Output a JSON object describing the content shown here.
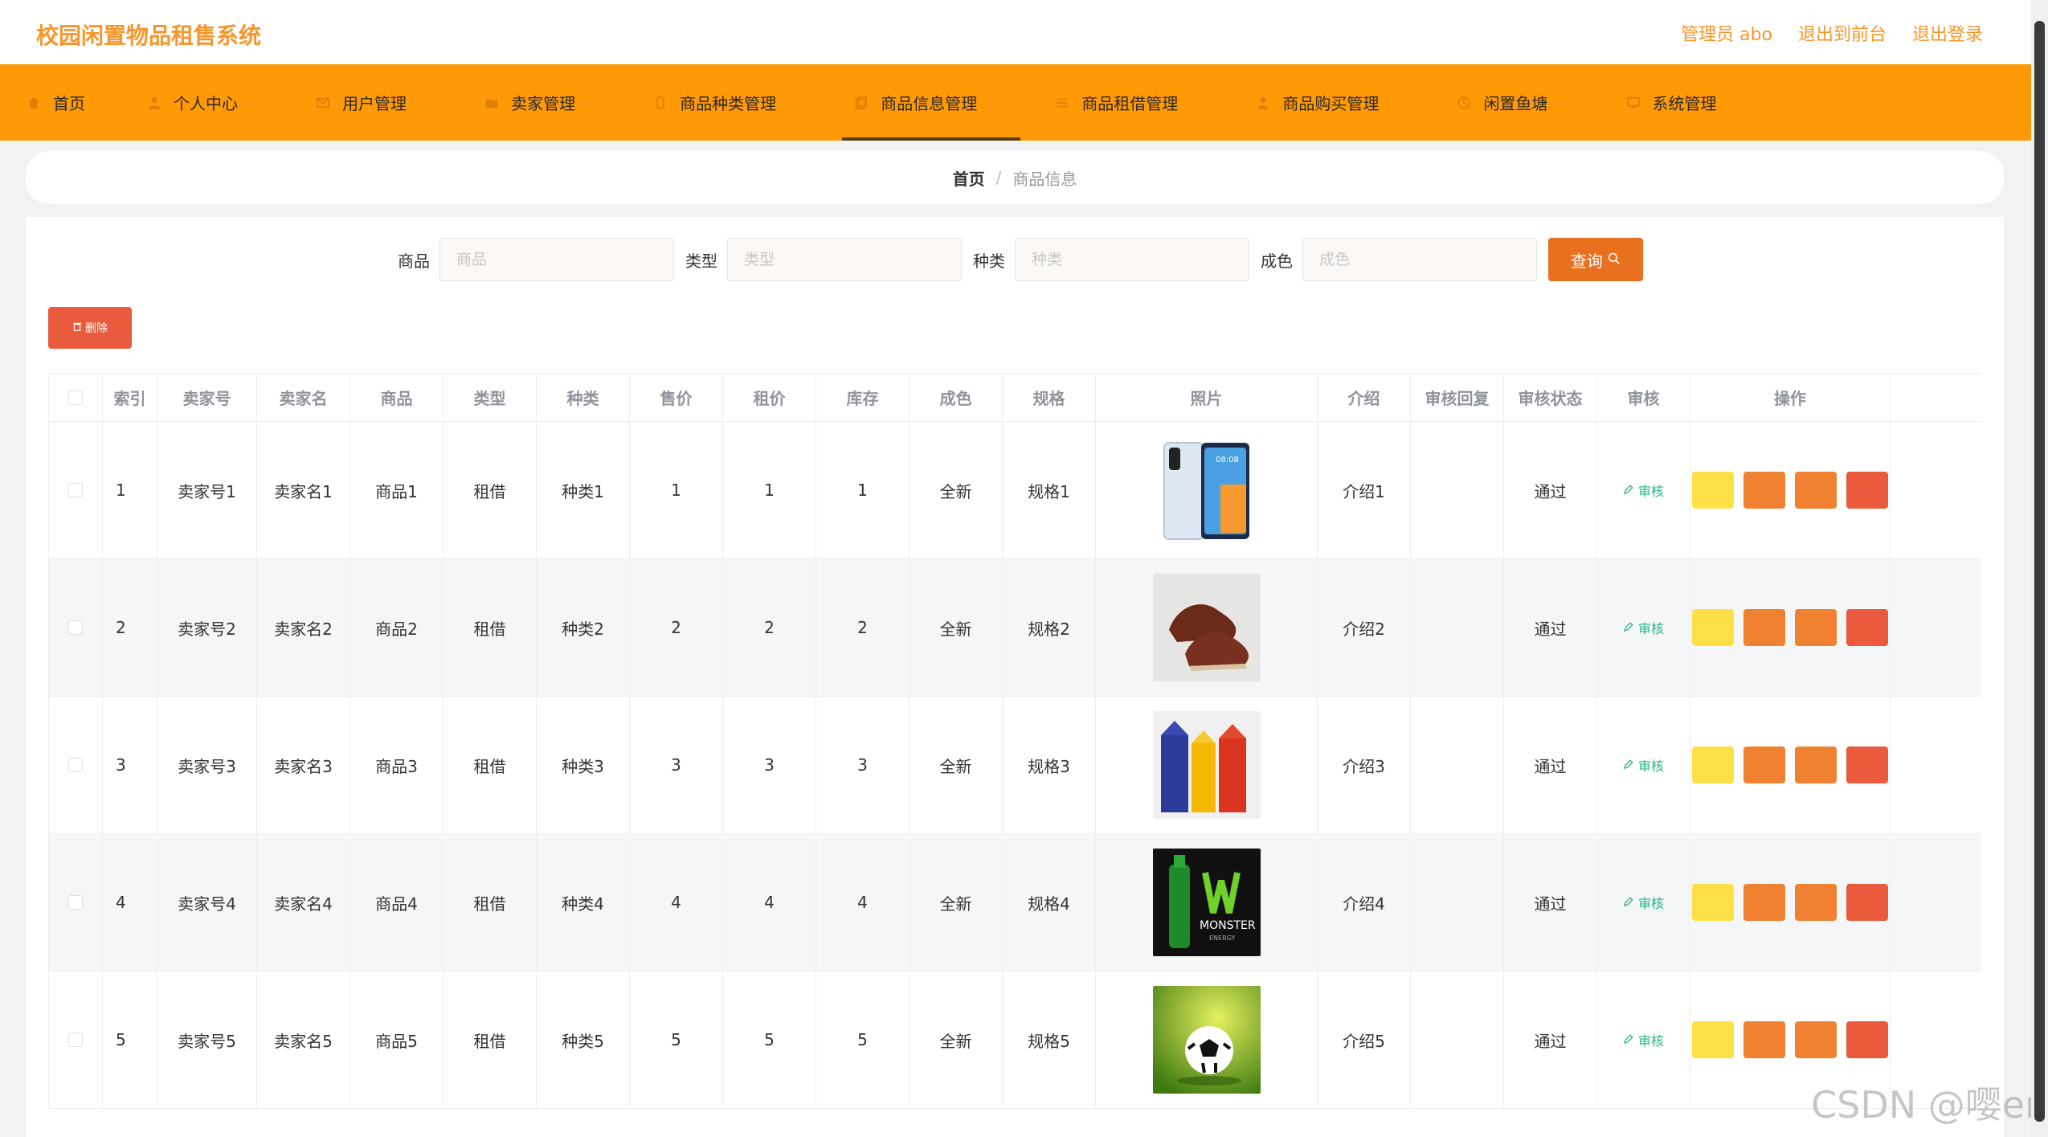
{
  "header": {
    "title": "校园闲置物品租售系统",
    "admin": "管理员 abo",
    "to_front": "退出到前台",
    "logout": "退出登录"
  },
  "nav": [
    {
      "label": "首页",
      "icon": "home-icon"
    },
    {
      "label": "个人中心",
      "icon": "user-icon"
    },
    {
      "label": "用户管理",
      "icon": "mail-icon"
    },
    {
      "label": "卖家管理",
      "icon": "folder-icon"
    },
    {
      "label": "商品种类管理",
      "icon": "phone-icon"
    },
    {
      "label": "商品信息管理",
      "icon": "copy-icon"
    },
    {
      "label": "商品租借管理",
      "icon": "list-icon"
    },
    {
      "label": "商品购买管理",
      "icon": "person-icon"
    },
    {
      "label": "闲置鱼塘",
      "icon": "clock-icon"
    },
    {
      "label": "系统管理",
      "icon": "screen-icon"
    }
  ],
  "breadcrumb": {
    "home": "首页",
    "current": "商品信息"
  },
  "search": {
    "fields": [
      {
        "label": "商品",
        "placeholder": "商品"
      },
      {
        "label": "类型",
        "placeholder": "类型"
      },
      {
        "label": "种类",
        "placeholder": "种类"
      },
      {
        "label": "成色",
        "placeholder": "成色"
      }
    ],
    "query_label": "查询"
  },
  "delete_label": "删除",
  "table": {
    "headers": [
      "",
      "索引",
      "卖家号",
      "卖家名",
      "商品",
      "类型",
      "种类",
      "售价",
      "租价",
      "库存",
      "成色",
      "规格",
      "照片",
      "介绍",
      "审核回复",
      "审核状态",
      "审核",
      "操作"
    ],
    "audit_label": "审核",
    "rows": [
      {
        "index": "1",
        "seller_no": "卖家号1",
        "seller_name": "卖家名1",
        "product": "商品1",
        "type": "租借",
        "kind": "种类1",
        "price": "1",
        "rent": "1",
        "stock": "1",
        "condition": "全新",
        "spec": "规格1",
        "photo": "phone",
        "intro": "介绍1",
        "reply": "",
        "status": "通过"
      },
      {
        "index": "2",
        "seller_no": "卖家号2",
        "seller_name": "卖家名2",
        "product": "商品2",
        "type": "租借",
        "kind": "种类2",
        "price": "2",
        "rent": "2",
        "stock": "2",
        "condition": "全新",
        "spec": "规格2",
        "photo": "shoes",
        "intro": "介绍2",
        "reply": "",
        "status": "通过"
      },
      {
        "index": "3",
        "seller_no": "卖家号3",
        "seller_name": "卖家名3",
        "product": "商品3",
        "type": "租借",
        "kind": "种类3",
        "price": "3",
        "rent": "3",
        "stock": "3",
        "condition": "全新",
        "spec": "规格3",
        "photo": "boxes",
        "intro": "介绍3",
        "reply": "",
        "status": "通过"
      },
      {
        "index": "4",
        "seller_no": "卖家号4",
        "seller_name": "卖家名4",
        "product": "商品4",
        "type": "租借",
        "kind": "种类4",
        "price": "4",
        "rent": "4",
        "stock": "4",
        "condition": "全新",
        "spec": "规格4",
        "photo": "energy-drink",
        "intro": "介绍4",
        "reply": "",
        "status": "通过"
      },
      {
        "index": "5",
        "seller_no": "卖家号5",
        "seller_name": "卖家名5",
        "product": "商品5",
        "type": "租借",
        "kind": "种类5",
        "price": "5",
        "rent": "5",
        "stock": "5",
        "condition": "全新",
        "spec": "规格5",
        "photo": "soccer-ball",
        "intro": "介绍5",
        "reply": "",
        "status": "通过"
      }
    ]
  },
  "watermark": "CSDN @嘤er",
  "colors": {
    "brand": "#ff9a06",
    "title": "#f7962a",
    "query": "#e8701e",
    "delete": "#ea5b3e",
    "audit": "#2bb38a"
  }
}
